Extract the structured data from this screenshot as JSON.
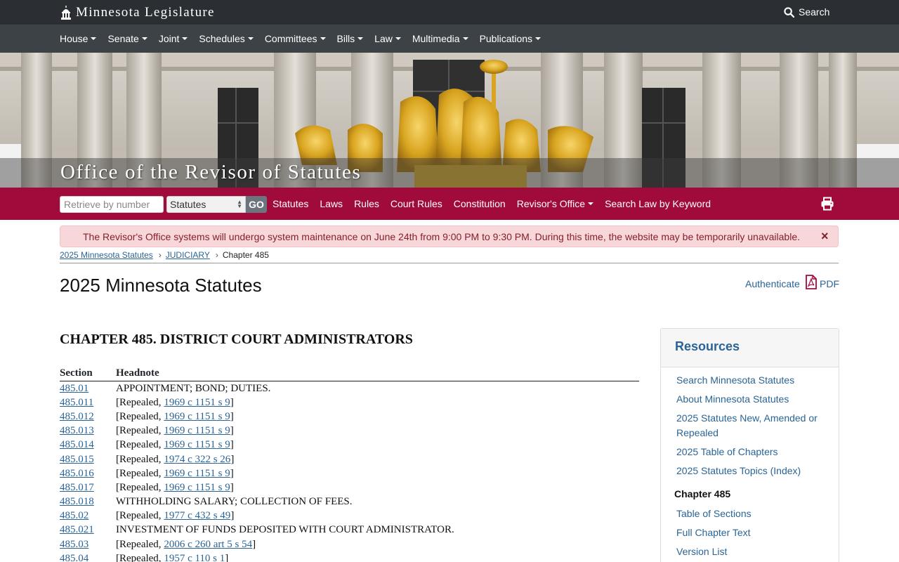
{
  "header": {
    "brand": "Minnesota Legislature",
    "search_label": "Search"
  },
  "main_nav": [
    {
      "label": "House"
    },
    {
      "label": "Senate"
    },
    {
      "label": "Joint"
    },
    {
      "label": "Schedules"
    },
    {
      "label": "Committees"
    },
    {
      "label": "Bills"
    },
    {
      "label": "Law"
    },
    {
      "label": "Multimedia"
    },
    {
      "label": "Publications"
    }
  ],
  "hero": {
    "title": "Office of the Revisor of Statutes"
  },
  "sub_nav": {
    "retrieve_placeholder": "Retrieve by number",
    "select_value": "Statutes",
    "go_label": "GO",
    "items": [
      {
        "label": "Statutes",
        "dropdown": false
      },
      {
        "label": "Laws",
        "dropdown": false
      },
      {
        "label": "Rules",
        "dropdown": false
      },
      {
        "label": "Court Rules",
        "dropdown": false
      },
      {
        "label": "Constitution",
        "dropdown": false
      },
      {
        "label": "Revisor's Office",
        "dropdown": true
      },
      {
        "label": "Search Law by Keyword",
        "dropdown": false
      }
    ]
  },
  "alert": {
    "text": "The Revisor's Office systems will undergo system maintenance on June 24th from 9:00 PM to 9:30 PM. During this time, the website may be temporarily unavailable.",
    "close": "×"
  },
  "breadcrumb": {
    "item1": "2025 Minnesota Statutes",
    "item2": "JUDICIARY",
    "current": "Chapter 485"
  },
  "page": {
    "title": "2025 Minnesota Statutes",
    "authenticate": "Authenticate",
    "pdf": "PDF"
  },
  "chapter": {
    "title": "CHAPTER 485. DISTRICT COURT ADMINISTRATORS",
    "col_section": "Section",
    "col_headnote": "Headnote",
    "rows": [
      {
        "section": "485.01",
        "text": "APPOINTMENT; BOND; DUTIES."
      },
      {
        "section": "485.011",
        "pre": "[Repealed, ",
        "link": "1969 c 1151 s 9",
        "post": "]"
      },
      {
        "section": "485.012",
        "pre": "[Repealed, ",
        "link": "1969 c 1151 s 9",
        "post": "]"
      },
      {
        "section": "485.013",
        "pre": "[Repealed, ",
        "link": "1969 c 1151 s 9",
        "post": "]"
      },
      {
        "section": "485.014",
        "pre": "[Repealed, ",
        "link": "1969 c 1151 s 9",
        "post": "]"
      },
      {
        "section": "485.015",
        "pre": "[Repealed, ",
        "link": "1974 c 322 s 26",
        "post": "]"
      },
      {
        "section": "485.016",
        "pre": "[Repealed, ",
        "link": "1969 c 1151 s 9",
        "post": "]"
      },
      {
        "section": "485.017",
        "pre": "[Repealed, ",
        "link": "1969 c 1151 s 9",
        "post": "]"
      },
      {
        "section": "485.018",
        "text": "WITHHOLDING SALARY; COLLECTION OF FEES."
      },
      {
        "section": "485.02",
        "pre": "[Repealed, ",
        "link": "1977 c 432 s 49",
        "post": "]"
      },
      {
        "section": "485.021",
        "text": "INVESTMENT OF FUNDS DEPOSITED WITH COURT ADMINISTRATOR."
      },
      {
        "section": "485.03",
        "pre": "[Repealed, ",
        "link": "2006 c 260 art 5 s 54",
        "post": "]"
      },
      {
        "section": "485.04",
        "pre": "[Repealed, ",
        "link": "1957 c 110 s 1",
        "post": "]"
      }
    ]
  },
  "resources": {
    "title": "Resources",
    "links": [
      "Search Minnesota Statutes",
      "About Minnesota Statutes",
      "2025 Statutes New, Amended or Repealed",
      "2025 Table of Chapters",
      "2025 Statutes Topics (Index)"
    ],
    "sub_title": "Chapter 485",
    "sub_links": [
      "Table of Sections",
      "Full Chapter Text",
      "Version List"
    ]
  },
  "colors": {
    "topbar": "#2b2f33",
    "mainnav": "#3d4247",
    "subnav": "#a10b3b",
    "link": "#2a6496",
    "alert_bg": "#f8d7da",
    "alert_text": "#842029"
  }
}
